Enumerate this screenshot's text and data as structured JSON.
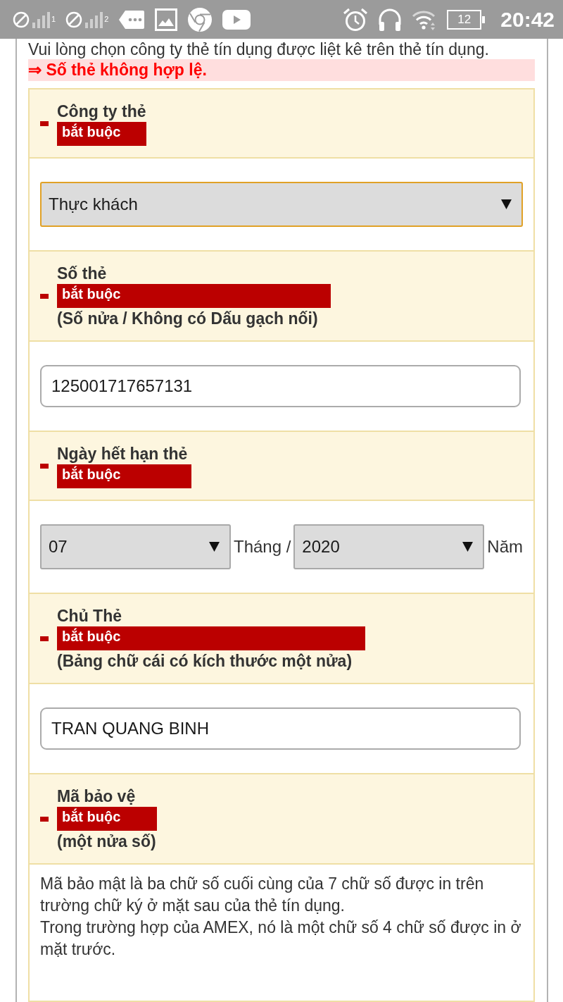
{
  "status_bar": {
    "signals": [
      {
        "slot": "1"
      },
      {
        "slot": "2"
      }
    ],
    "battery": "12",
    "time": "20:42"
  },
  "intro": "Vui lòng chọn công ty thẻ tín dụng được liệt kê trên thẻ tín dụng.",
  "error": "⇒ Số thẻ không hợp lệ.",
  "fields": [
    {
      "kind": "select",
      "label": "Công ty thẻ",
      "required": "bắt buộc",
      "value": "Thực khách",
      "focused": true
    },
    {
      "kind": "text",
      "label": "Số thẻ",
      "required": "bắt buộc",
      "hint": "(Số nửa / Không có Dấu gạch nối)",
      "value": "125001717657131"
    },
    {
      "kind": "date",
      "label": "Ngày hết hạn thẻ",
      "required": "bắt buộc",
      "parts": [
        {
          "value": "07",
          "unit": "Tháng /",
          "focused": false
        },
        {
          "value": "2020",
          "unit": "Năm",
          "focused": false
        }
      ]
    },
    {
      "kind": "text",
      "label": "Chủ Thẻ",
      "required": "bắt buộc",
      "hint": "(Bảng chữ cái có kích thước một nửa)",
      "value": "TRAN QUANG BINH"
    },
    {
      "kind": "info",
      "label": "Mã bảo vệ",
      "required": "bắt buộc",
      "hint": "(một nửa số)",
      "info": [
        "Mã bảo mật là ba chữ số cuối cùng của 7 chữ số được in trên trường chữ ký ở mặt sau của thẻ tín dụng.",
        "Trong trường hợp của AMEX, nó là một chữ số 4 chữ số được in ở mặt trước."
      ]
    }
  ]
}
